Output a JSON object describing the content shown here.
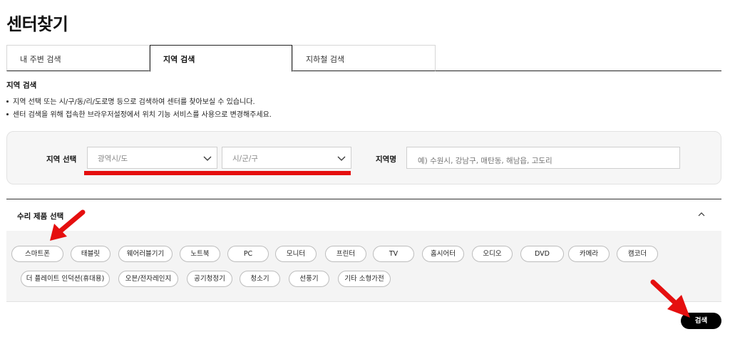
{
  "page": {
    "title": "센터찾기"
  },
  "tabs": [
    {
      "label": "내 주변 검색",
      "active": false
    },
    {
      "label": "지역 검색",
      "active": true
    },
    {
      "label": "지하철 검색",
      "active": false
    }
  ],
  "region_search": {
    "heading": "지역 검색",
    "descriptions": [
      "지역 선택 또는 시/구/동/리/도로명 등으로 검색하여 센터를 찾아보실 수 있습니다.",
      "센터 검색을 위해 접속한 브라우저설정에서 위치 기능 서비스를 사용으로 변경해주세요."
    ],
    "region_label": "지역 선택",
    "province_select": {
      "value": "광역시/도"
    },
    "city_select": {
      "value": "시/군/구"
    },
    "name_label": "지역명",
    "name_input": {
      "value": "",
      "placeholder": "예) 수원시, 강남구, 매탄동, 해남읍, 고도리"
    }
  },
  "products": {
    "title": "수리 제품 선택",
    "items": [
      "스마트폰",
      "태블릿",
      "웨어러블기기",
      "노트북",
      "PC",
      "모니터",
      "프린터",
      "TV",
      "홈시어터",
      "오디오",
      "DVD",
      "카메라",
      "캠코더",
      "더 플레이트 인덕션(휴대용)",
      "오븐/전자레인지",
      "공기청정기",
      "청소기",
      "선풍기",
      "기타 소형가전"
    ]
  },
  "actions": {
    "search_label": "검색"
  },
  "colors": {
    "accent_red": "#e50f0f",
    "button_black": "#000000",
    "panel_gray": "#f4f4f4"
  },
  "icons": {
    "select_arrow": "chevron-down-icon",
    "collapse": "chevron-up-icon",
    "annotation": "red-arrow-icon"
  }
}
